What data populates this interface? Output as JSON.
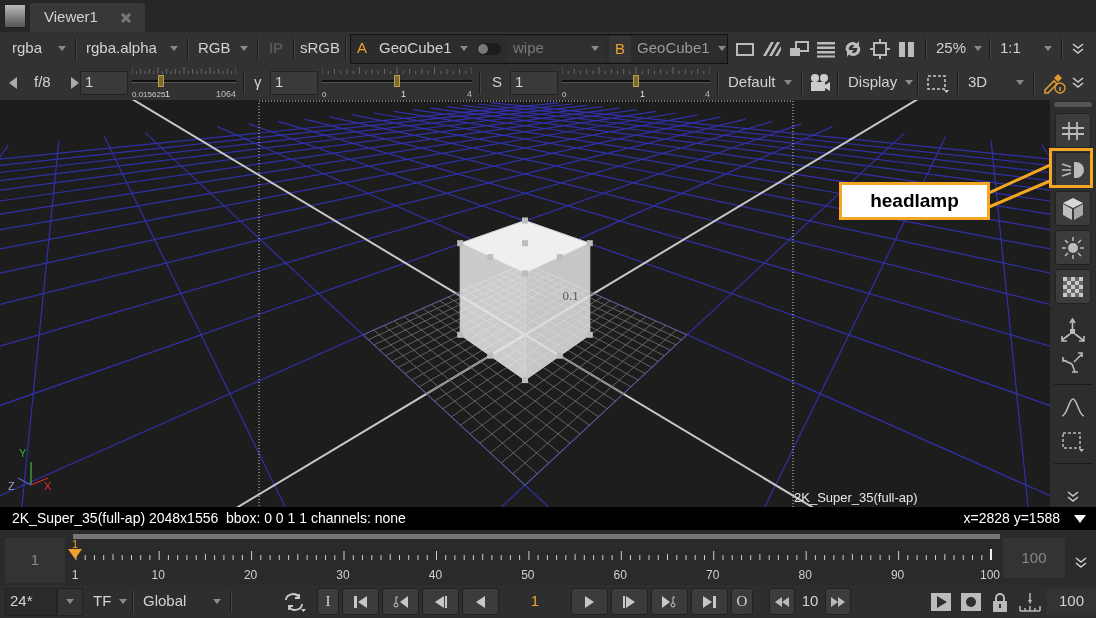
{
  "tab": {
    "label": "Viewer1"
  },
  "toolbar": {
    "channels": "rgba",
    "layer": "rgba.alpha",
    "display": "RGB",
    "ip": {
      "label": "IP",
      "disabled": true
    },
    "lut": "sRGB",
    "input_a": {
      "letter": "A",
      "node": "GeoCube1"
    },
    "wipe": {
      "label": "wipe",
      "on": false
    },
    "input_b": {
      "letter": "B",
      "node": "GeoCube1"
    },
    "zoom": "25%",
    "ratio": "1:1"
  },
  "controls": {
    "gain": {
      "label": "f/8",
      "value": "1",
      "level": 0.28,
      "scale": [
        "0.015625",
        "1",
        "1064"
      ]
    },
    "gamma": {
      "label": "γ",
      "value": "1",
      "level": 0.5,
      "scale": [
        "0",
        "1",
        "4"
      ]
    },
    "saturation": {
      "label": "S",
      "value": "1",
      "level": 0.5,
      "scale": [
        "0",
        "1",
        "4"
      ]
    },
    "viewer_process": "Default",
    "display": "Display",
    "view_mode": "3D"
  },
  "viewport": {
    "format_label": "2K_Super_35(full-ap)",
    "cube_label": "0.1",
    "axes": [
      "Y",
      "Z",
      "X"
    ],
    "callout": "headlamp"
  },
  "status_bar": {
    "info": "2K_Super_35(full-ap) 2048x1556  bbox: 0 0 1 1 channels: none",
    "cursor": "x=2828 y=1588"
  },
  "timeline": {
    "in_frame": "1",
    "marker": "1",
    "labels": [
      "1",
      "10",
      "20",
      "30",
      "40",
      "50",
      "60",
      "70",
      "80",
      "90",
      "100"
    ],
    "out_frame": "100"
  },
  "playback": {
    "fps": "24*",
    "time_mode": "TF",
    "scope": "Global",
    "back": [
      {
        "kind": "in_point",
        "label": "I"
      },
      {
        "kind": "first"
      },
      {
        "kind": "prev_key"
      },
      {
        "kind": "prev_frame"
      },
      {
        "kind": "play_reverse"
      }
    ],
    "frame": "1",
    "forward": [
      {
        "kind": "play"
      },
      {
        "kind": "next_frame"
      },
      {
        "kind": "next_key"
      },
      {
        "kind": "last"
      },
      {
        "kind": "out_point",
        "label": "O"
      }
    ],
    "increment": "10",
    "end_frame": "100"
  }
}
